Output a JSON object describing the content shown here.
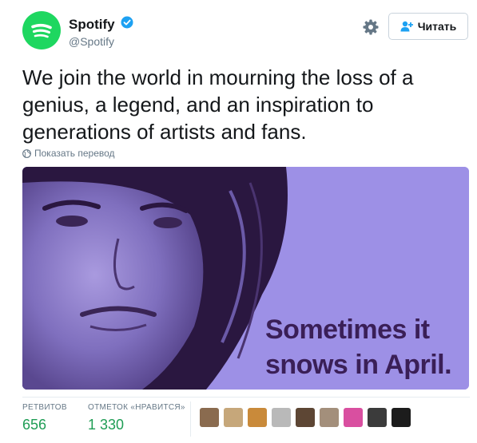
{
  "account": {
    "name": "Spotify",
    "handle": "@Spotify",
    "brand_color": "#1ED760",
    "verified": true
  },
  "follow_button": {
    "label": "Читать"
  },
  "tweet": {
    "text": "We join the world in mourning the loss of a genius, a legend, and an inspiration to generations of artists and fans.",
    "translate_label": "Показать перевод"
  },
  "media": {
    "overlay_line1": "Sometimes it",
    "overlay_line2": "snows in April.",
    "tint_color": "#9D90E6",
    "text_color": "#3A1F57"
  },
  "stats": {
    "retweets_label": "РЕТВИТОВ",
    "retweets_value": "656",
    "likes_label": "ОТМЕТОК «НРАВИТСЯ»",
    "likes_value": "1 330",
    "value_color": "#1F9D55"
  },
  "likers": [
    {
      "color": "#8a6b4f"
    },
    {
      "color": "#c6a77a"
    },
    {
      "color": "#c98a3a"
    },
    {
      "color": "#b9b9b9"
    },
    {
      "color": "#5d4634"
    },
    {
      "color": "#a38f7b"
    },
    {
      "color": "#d94fa0"
    },
    {
      "color": "#3b3b3b"
    },
    {
      "color": "#1c1c1c"
    }
  ]
}
